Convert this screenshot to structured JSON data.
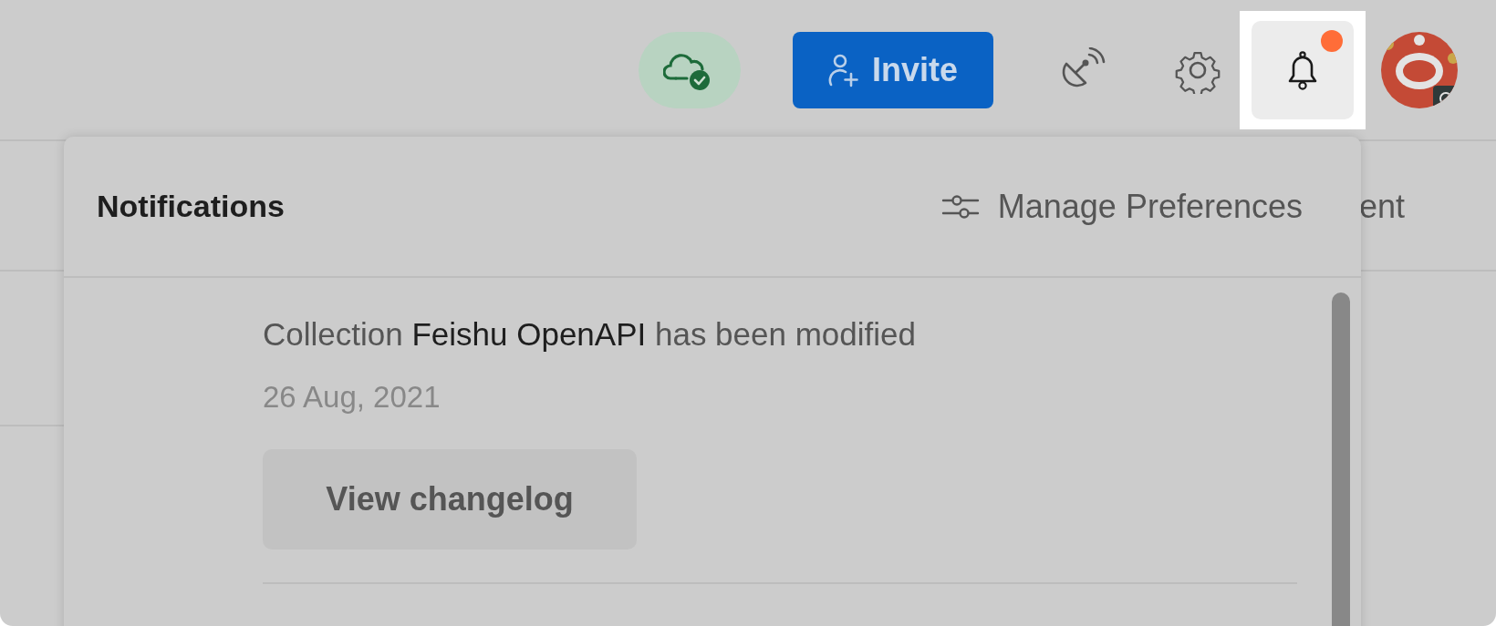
{
  "header": {
    "invite_button": {
      "label": "Invite"
    },
    "notifications_button": {
      "selected": true,
      "unread": true
    }
  },
  "background": {
    "text_fragment": "ent"
  },
  "notifications_panel": {
    "title": "Notifications",
    "manage_link": "Manage Preferences",
    "items": [
      {
        "message": {
          "before": "Collection ",
          "subject": "Feishu OpenAPI",
          "after": " has been modified"
        },
        "date": "26 Aug, 2021",
        "action": "View changelog"
      }
    ]
  }
}
